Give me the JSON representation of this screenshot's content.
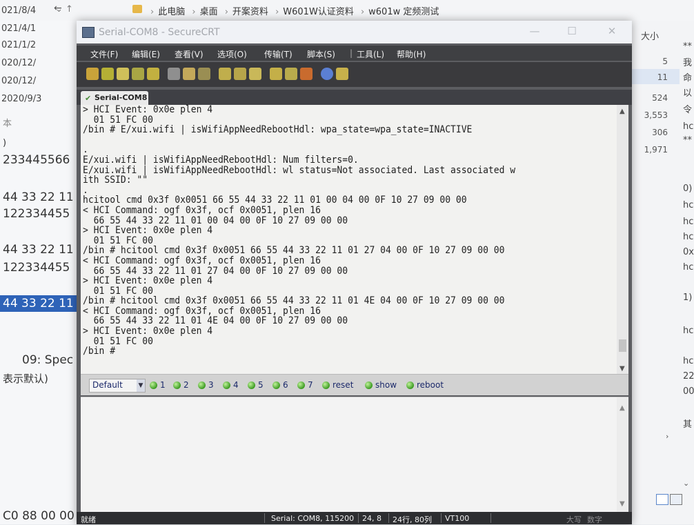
{
  "explorer": {
    "breadcrumbs": [
      "此电脑",
      "桌面",
      "开案资料",
      "W601W认证资料",
      "w601w 定频测试"
    ],
    "dates": [
      "021/8/4",
      "021/4/1",
      "021/1/2",
      "020/12/",
      "020/12/",
      "2020/9/3"
    ],
    "left_texts": [
      "本",
      ")",
      "233445566",
      "44 33 22 11",
      "122334455",
      "44 33 22 11",
      "122334455",
      "44 33 22 11",
      "09: Spec",
      "表示默认)",
      "C0 88 00 00"
    ],
    "right_header": "大小",
    "sizes": [
      "5",
      "11",
      "524",
      "3,553",
      "306",
      "1,971"
    ],
    "right_fragments": [
      "**",
      "我",
      "命",
      "以",
      "令",
      "hc",
      "**",
      "0)",
      "hc",
      "hc",
      "hc",
      "0x",
      "hc",
      "1)",
      "hc",
      "hc",
      "22",
      "00",
      "其"
    ]
  },
  "window": {
    "title": "Serial-COM8 - SecureCRT",
    "menu": [
      "文件(F)",
      "编辑(E)",
      "查看(V)",
      "选项(O)",
      "传输(T)",
      "脚本(S)",
      "工具(L)",
      "帮助(H)"
    ],
    "tab_label": "Serial-COM8"
  },
  "terminal": {
    "lines": [
      "> HCI Event: 0x0e plen 4",
      "  01 51 FC 00",
      "/bin # E/xui.wifi | isWifiAppNeedRebootHdl: wpa_state=wpa_state=INACTIVE",
      "",
      ".",
      "E/xui.wifi | isWifiAppNeedRebootHdl: Num filters=0.",
      "E/xui.wifi | isWifiAppNeedRebootHdl: wl status=Not associated. Last associated w",
      "ith SSID: \"\"",
      ".",
      "hcitool cmd 0x3f 0x0051 66 55 44 33 22 11 01 00 04 00 0F 10 27 09 00 00",
      "< HCI Command: ogf 0x3f, ocf 0x0051, plen 16",
      "  66 55 44 33 22 11 01 00 04 00 0F 10 27 09 00 00",
      "> HCI Event: 0x0e plen 4",
      "  01 51 FC 00",
      "/bin # hcitool cmd 0x3f 0x0051 66 55 44 33 22 11 01 27 04 00 0F 10 27 09 00 00",
      "< HCI Command: ogf 0x3f, ocf 0x0051, plen 16",
      "  66 55 44 33 22 11 01 27 04 00 0F 10 27 09 00 00",
      "> HCI Event: 0x0e plen 4",
      "  01 51 FC 00",
      "/bin # hcitool cmd 0x3f 0x0051 66 55 44 33 22 11 01 4E 04 00 0F 10 27 09 00 00",
      "< HCI Command: ogf 0x3f, ocf 0x0051, plen 16",
      "  66 55 44 33 22 11 01 4E 04 00 0F 10 27 09 00 00",
      "> HCI Event: 0x0e plen 4",
      "  01 51 FC 00",
      "/bin # "
    ]
  },
  "button_bar": {
    "selected": "Default",
    "buttons": [
      "1",
      "2",
      "3",
      "4",
      "5",
      "6",
      "7",
      "reset",
      "show",
      "reboot"
    ]
  },
  "status": {
    "ready": "就绪",
    "connection": "Serial: COM8, 115200",
    "cursor": "24,  8",
    "size": "24行, 80列",
    "emulation": "VT100",
    "caps": "大写",
    "num": "数字"
  }
}
